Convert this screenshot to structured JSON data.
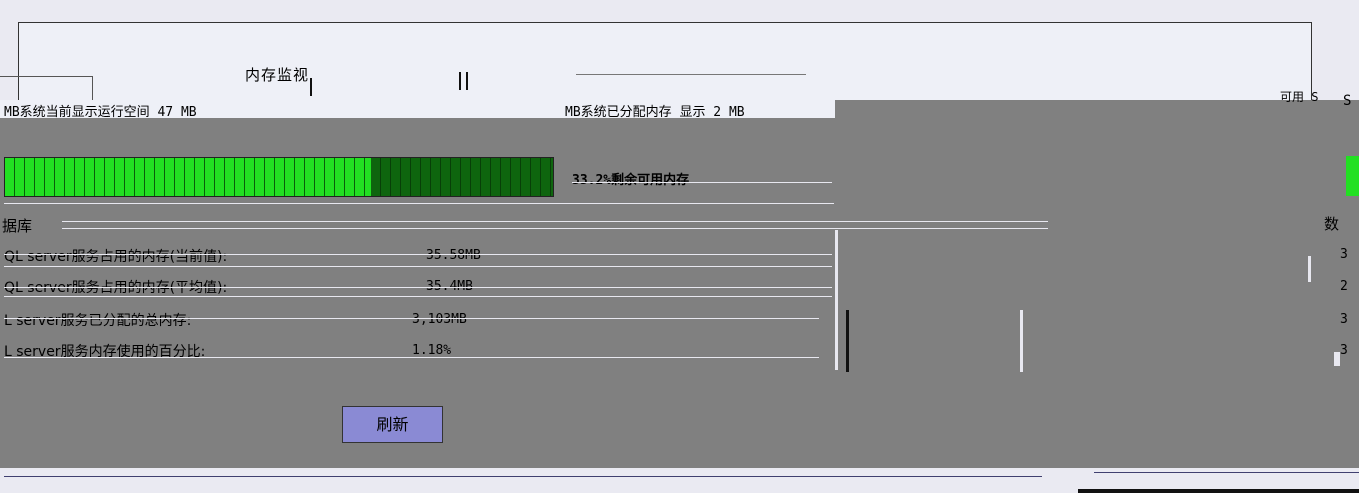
{
  "window": {
    "title": "内存监视"
  },
  "memory_stats": {
    "left_label": "MB系统当前显示运行空间 47 MB",
    "mid_label": "MB系统已分配内存 显示 2 MB",
    "right_fragment": "可用 S"
  },
  "progress": {
    "percent_free": 33.2,
    "text": "33.2%剩余可用内存"
  },
  "database": {
    "title": "据库",
    "rows": [
      {
        "label": "QL server服务占用的内存(当前值):",
        "value": "35.58MB"
      },
      {
        "label": "QL server服务占用的内存(平均值):",
        "value": "35.4MB"
      },
      {
        "label": "L server服务已分配的总内存:",
        "value": "3,103MB"
      },
      {
        "label": "L server服务内存使用的百分比:",
        "value": "1.18%"
      }
    ]
  },
  "actions": {
    "refresh_label": "刷新"
  },
  "right_panel": {
    "letter": "S",
    "db_title": "数",
    "values": [
      "3",
      "2",
      "3",
      "3"
    ]
  },
  "colors": {
    "panel_bg": "#808080",
    "progress_fill": "#22e022",
    "progress_empty": "#0e650e",
    "button_bg": "#8a8ad4"
  }
}
